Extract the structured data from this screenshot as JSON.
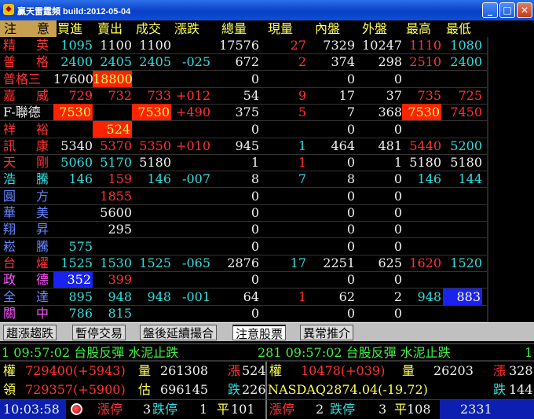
{
  "window": {
    "title": "贏天雷霆頻 build:2012-05-04",
    "minimize_label": "_",
    "maximize_label": "□",
    "close_label": "✕"
  },
  "header": {
    "name1": "注",
    "name2": "意",
    "columns": [
      "買進",
      "賣出",
      "成交",
      "漲跌",
      "總量",
      "現量",
      "內盤",
      "外盤",
      "最高",
      "最低"
    ]
  },
  "rows": [
    {
      "n1": "精",
      "n2": "英",
      "nc": "red",
      "buy": "1095",
      "sell": "1100",
      "trade": "1100",
      "chg": "",
      "vol": "17576",
      "cur": "27",
      "inner": "7329",
      "outer": "10247",
      "high": "1110",
      "low": "1080",
      "colors": {
        "buy": "cyan",
        "sell": "white",
        "trade": "white",
        "cur": "red",
        "high": "red",
        "low": "cyan"
      }
    },
    {
      "n1": "普",
      "n2": "格",
      "nc": "red",
      "buy": "2400",
      "sell": "2405",
      "trade": "2405",
      "chg": "-025",
      "vol": "672",
      "cur": "2",
      "inner": "374",
      "outer": "298",
      "high": "2510",
      "low": "2400",
      "colors": {
        "buy": "cyan",
        "sell": "cyan",
        "trade": "cyan",
        "chg": "cyan",
        "cur": "red",
        "high": "red",
        "low": "cyan"
      }
    },
    {
      "n1": "普格三",
      "n2": "",
      "nc": "red",
      "buy": "17600",
      "sell": "18800",
      "trade": "",
      "chg": "",
      "vol": "0",
      "cur": "",
      "inner": "0",
      "outer": "0",
      "high": "",
      "low": "",
      "colors": {
        "buy": "white",
        "sell": "hlred"
      }
    },
    {
      "n1": "嘉",
      "n2": "威",
      "nc": "red",
      "buy": "729",
      "sell": "732",
      "trade": "733",
      "chg": "+012",
      "vol": "54",
      "cur": "9",
      "inner": "17",
      "outer": "37",
      "high": "735",
      "low": "725",
      "colors": {
        "buy": "red",
        "sell": "red",
        "trade": "red",
        "chg": "red",
        "cur": "red",
        "high": "red",
        "low": "red"
      }
    },
    {
      "n1": "F-聯德",
      "n2": "",
      "nc": "white",
      "buy": "7530",
      "sell": "",
      "trade": "7530",
      "chg": "+490",
      "vol": "375",
      "cur": "5",
      "inner": "7",
      "outer": "368",
      "high": "7530",
      "low": "7450",
      "colors": {
        "buy": "hlred",
        "trade": "hlred",
        "chg": "red",
        "cur": "red",
        "high": "hlred",
        "low": "red"
      }
    },
    {
      "n1": "祥",
      "n2": "裕",
      "nc": "red",
      "buy": "",
      "sell": "524",
      "trade": "",
      "chg": "",
      "vol": "0",
      "cur": "",
      "inner": "0",
      "outer": "0",
      "high": "",
      "low": "",
      "colors": {
        "sell": "hlred"
      }
    },
    {
      "n1": "訊",
      "n2": "康",
      "nc": "red",
      "buy": "5340",
      "sell": "5370",
      "trade": "5350",
      "chg": "+010",
      "vol": "945",
      "cur": "1",
      "inner": "464",
      "outer": "481",
      "high": "5440",
      "low": "5200",
      "colors": {
        "buy": "white",
        "sell": "red",
        "trade": "red",
        "chg": "red",
        "cur": "cyan",
        "high": "red",
        "low": "cyan"
      }
    },
    {
      "n1": "天",
      "n2": "剛",
      "nc": "red",
      "buy": "5060",
      "sell": "5170",
      "trade": "5180",
      "chg": "",
      "vol": "1",
      "cur": "1",
      "inner": "0",
      "outer": "1",
      "high": "5180",
      "low": "5180",
      "colors": {
        "buy": "cyan",
        "sell": "cyan",
        "trade": "white",
        "cur": "red",
        "high": "white",
        "low": "white"
      }
    },
    {
      "n1": "浩",
      "n2": "騰",
      "nc": "cyan",
      "buy": "146",
      "sell": "159",
      "trade": "146",
      "chg": "-007",
      "vol": "8",
      "cur": "7",
      "inner": "8",
      "outer": "0",
      "high": "146",
      "low": "144",
      "colors": {
        "buy": "cyan",
        "sell": "red",
        "trade": "cyan",
        "chg": "cyan",
        "cur": "cyan",
        "high": "cyan",
        "low": "cyan"
      }
    },
    {
      "n1": "圓",
      "n2": "方",
      "nc": "blue",
      "buy": "",
      "sell": "1855",
      "trade": "",
      "chg": "",
      "vol": "0",
      "cur": "",
      "inner": "0",
      "outer": "0",
      "high": "",
      "low": "",
      "colors": {
        "sell": "red"
      }
    },
    {
      "n1": "華",
      "n2": "美",
      "nc": "blue",
      "buy": "",
      "sell": "5600",
      "trade": "",
      "chg": "",
      "vol": "0",
      "cur": "",
      "inner": "0",
      "outer": "0",
      "high": "",
      "low": "",
      "colors": {
        "sell": "white"
      }
    },
    {
      "n1": "翔",
      "n2": "昇",
      "nc": "blue",
      "buy": "",
      "sell": "295",
      "trade": "",
      "chg": "",
      "vol": "0",
      "cur": "",
      "inner": "0",
      "outer": "0",
      "high": "",
      "low": "",
      "colors": {
        "sell": "white"
      }
    },
    {
      "n1": "崧",
      "n2": "騰",
      "nc": "blue",
      "buy": "575",
      "sell": "",
      "trade": "",
      "chg": "",
      "vol": "0",
      "cur": "",
      "inner": "0",
      "outer": "0",
      "high": "",
      "low": "",
      "colors": {
        "buy": "cyan"
      }
    },
    {
      "n1": "台",
      "n2": "燿",
      "nc": "red",
      "buy": "1525",
      "sell": "1530",
      "trade": "1525",
      "chg": "-065",
      "vol": "2876",
      "cur": "17",
      "inner": "2251",
      "outer": "625",
      "high": "1620",
      "low": "1520",
      "colors": {
        "buy": "cyan",
        "sell": "cyan",
        "trade": "cyan",
        "chg": "cyan",
        "cur": "cyan",
        "high": "red",
        "low": "cyan"
      }
    },
    {
      "n1": "政",
      "n2": "德",
      "nc": "pink",
      "buy": "352",
      "sell": "399",
      "trade": "",
      "chg": "",
      "vol": "0",
      "cur": "",
      "inner": "0",
      "outer": "0",
      "high": "",
      "low": "",
      "colors": {
        "buy": "hlblue",
        "sell": "red"
      }
    },
    {
      "n1": "全",
      "n2": "達",
      "nc": "blue",
      "buy": "895",
      "sell": "948",
      "trade": "948",
      "chg": "-001",
      "vol": "64",
      "cur": "1",
      "inner": "62",
      "outer": "2",
      "high": "948",
      "low": "883",
      "colors": {
        "buy": "cyan",
        "sell": "cyan",
        "trade": "cyan",
        "chg": "cyan",
        "cur": "red",
        "high": "cyan",
        "low": "hlblue"
      }
    },
    {
      "n1": "關",
      "n2": "中",
      "nc": "pink",
      "buy": "786",
      "sell": "815",
      "trade": "",
      "chg": "",
      "vol": "0",
      "cur": "",
      "inner": "0",
      "outer": "0",
      "high": "",
      "low": "",
      "colors": {
        "buy": "cyan",
        "sell": "cyan"
      }
    }
  ],
  "tabs": [
    "趨漲趨跌",
    "暫停交易",
    "盤後延續撮合",
    "注意股票",
    "異常推介"
  ],
  "active_tab": 3,
  "ticker": {
    "left": "1  09:57:02  台股反彈  水泥止跌",
    "right": "281  09:57:02  台股反彈  水泥止跌",
    "tail": "1"
  },
  "info": {
    "quan_label": "權",
    "quan_value": "729400(+5943)",
    "vol_label": "量",
    "vol_value": "261308",
    "up_label": "漲",
    "up_value": "524",
    "ling_label": "領",
    "ling_value": "729357(+5900)",
    "est_label": "估",
    "est_value": "696145",
    "down_label": "跌",
    "down_value": "226",
    "right_quan_label": "權",
    "right_quan_value": "10478(+039)",
    "right_vol_label": "量",
    "right_vol_value": "26203",
    "right_up_label": "漲",
    "right_up_value": "328",
    "nasdaq": "NASDAQ2874.04(-19.72)",
    "right_down_label": "跌",
    "right_down_value": "144",
    "clock": "10:03:58",
    "limit_up_label": "漲停",
    "limit_up_value": "3",
    "limit_down_label": "跌停",
    "limit_down_value": "1",
    "flat_label": "平",
    "flat_value": "101",
    "r_limit_up_label": "漲停",
    "r_limit_up_value": "2",
    "r_limit_down_label": "跌停",
    "r_limit_down_value": "3",
    "r_flat_label": "平",
    "r_flat_value": "108",
    "r_count": "2331"
  }
}
